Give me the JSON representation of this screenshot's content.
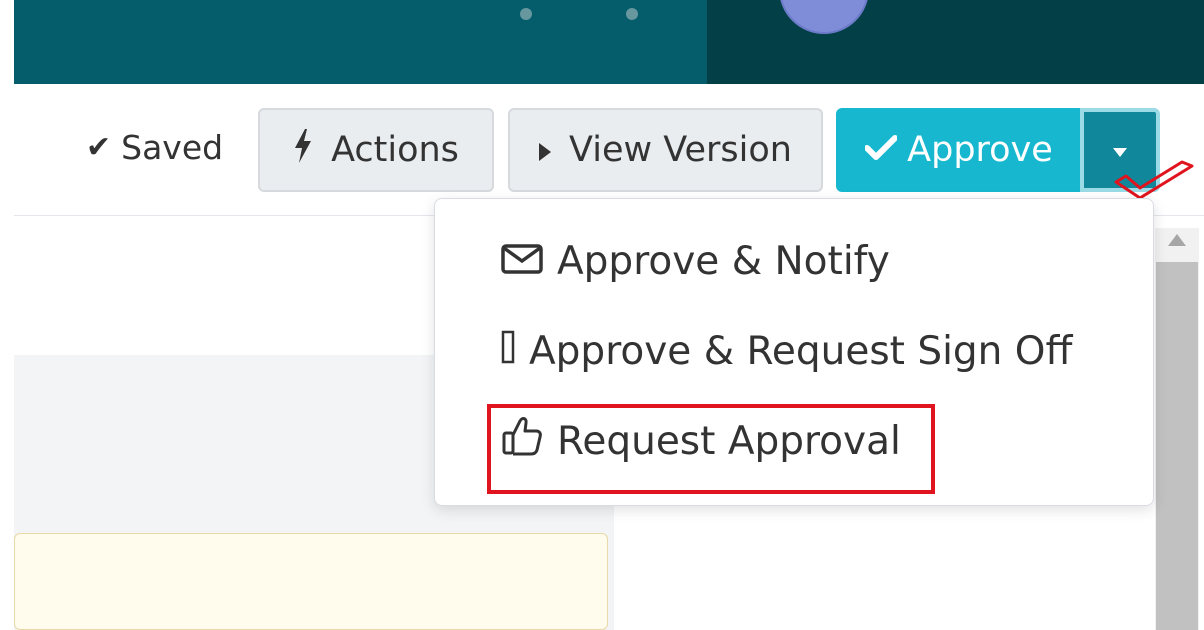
{
  "toolbar": {
    "saved_label": "Saved",
    "actions_label": "Actions",
    "view_version_label": "View Version",
    "approve_label": "Approve"
  },
  "dropdown": {
    "items": [
      {
        "label": "Approve & Notify",
        "icon": "envelope-icon"
      },
      {
        "label": "Approve & Request Sign Off",
        "icon": "missing-glyph-icon"
      },
      {
        "label": "Request Approval",
        "icon": "thumbs-up-icon",
        "highlighted": true
      }
    ]
  },
  "colors": {
    "header": "#055d6b",
    "header_dark": "#033f47",
    "approve": "#17b8cf",
    "approve_caret": "#10879a",
    "highlight": "#e0141e"
  }
}
